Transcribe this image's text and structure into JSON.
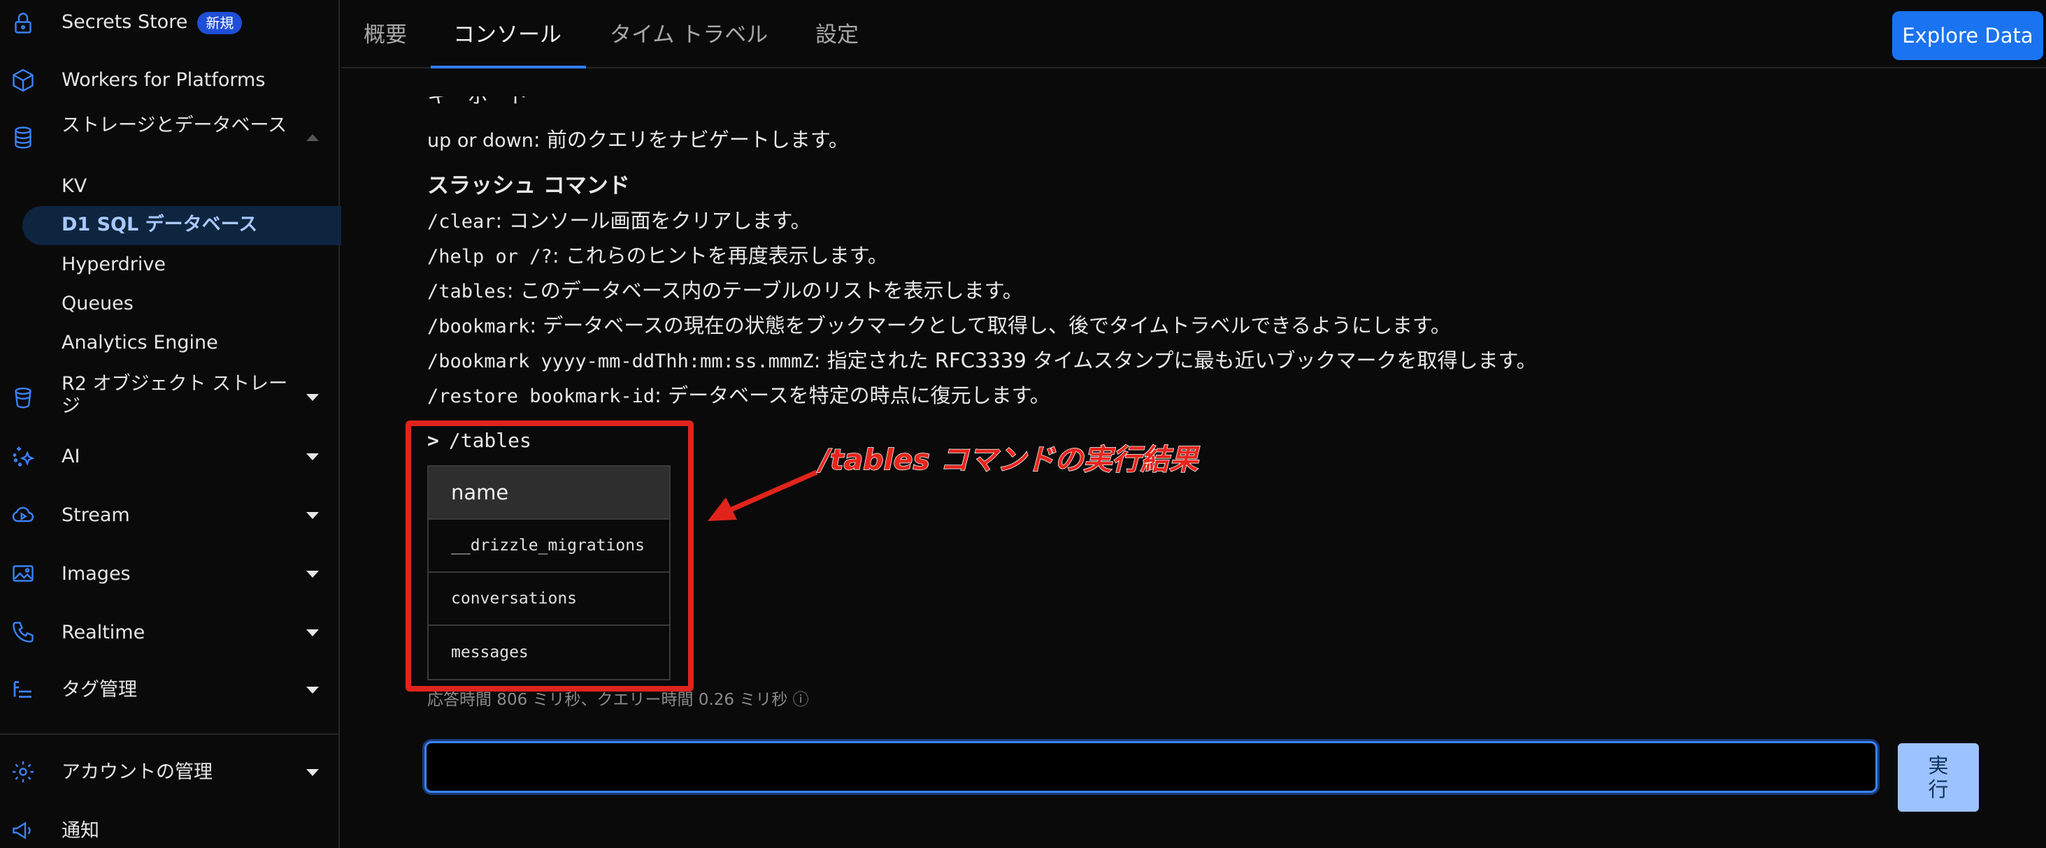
{
  "sidebar": {
    "secrets_store": "Secrets Store",
    "secrets_badge": "新規",
    "workers_platforms": "Workers for Platforms",
    "storage": "ストレージとデータベース",
    "kv": "KV",
    "d1": "D1 SQL データベース",
    "hyperdrive": "Hyperdrive",
    "queues": "Queues",
    "analytics_engine": "Analytics Engine",
    "r2": "R2 オブジェクト ストレージ",
    "ai": "AI",
    "stream": "Stream",
    "images": "Images",
    "realtime": "Realtime",
    "tags": "タグ管理",
    "account": "アカウントの管理",
    "notifications": "通知"
  },
  "tabs": [
    "概要",
    "コンソール",
    "タイム トラベル",
    "設定"
  ],
  "active_tab": "コンソール",
  "explore_button": "Explore Data",
  "help": {
    "nav_key": "up or down",
    "nav_desc": ": 前のクエリをナビゲートします。",
    "slash_heading": "スラッシュ コマンド",
    "commands": [
      {
        "cmd": "/clear",
        "desc": ": コンソール画面をクリアします。"
      },
      {
        "cmd": "/help or /?",
        "desc": ": これらのヒントを再度表示します。"
      },
      {
        "cmd": "/tables",
        "desc": ": このデータベース内のテーブルのリストを表示します。"
      },
      {
        "cmd": "/bookmark",
        "desc": ": データベースの現在の状態をブックマークとして取得し、後でタイムトラベルできるようにします。"
      },
      {
        "cmd": "/bookmark yyyy-mm-ddThh:mm:ss.mmmZ",
        "desc": ": 指定された RFC3339 タイムスタンプに最も近いブックマークを取得します。"
      },
      {
        "cmd": "/restore bookmark-id",
        "desc": ": データベースを特定の時点に復元します。"
      }
    ]
  },
  "result": {
    "prompt_symbol": ">",
    "command": "/tables",
    "column": "name",
    "rows": [
      "__drizzle_migrations",
      "conversations",
      "messages"
    ],
    "timing": "応答時間 806 ミリ秒、クエリー時間 0.26 ミリ秒 ⓘ"
  },
  "annotation": {
    "text": "/tables コマンドの実行結果",
    "color": "#e0241c"
  },
  "input": {
    "value": "",
    "placeholder": ""
  },
  "run_button": [
    "実",
    "行"
  ],
  "colors": {
    "accent": "#1a73f0",
    "active_nav_bg": "#0e2540",
    "active_nav_text": "#a8c8ff"
  }
}
